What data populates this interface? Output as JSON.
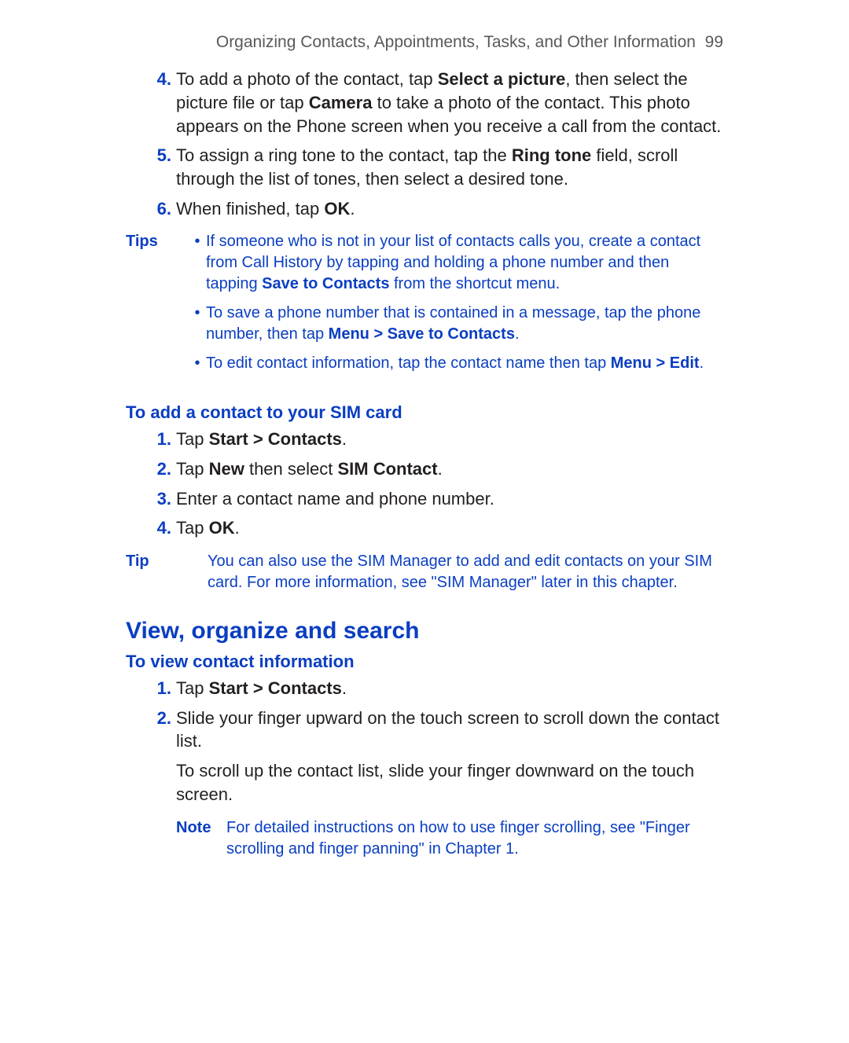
{
  "header": {
    "title": "Organizing Contacts, Appointments, Tasks, and Other Information",
    "page_number": "99"
  },
  "steps_a": {
    "s4": {
      "num": "4.",
      "pre": "To add a photo of the contact, tap ",
      "b1": "Select a picture",
      "mid1": ", then select the picture file or tap ",
      "b2": "Camera",
      "post": " to take a photo of the contact. This photo appears on the Phone screen when you receive a call from the contact."
    },
    "s5": {
      "num": "5.",
      "pre": "To assign a ring tone to the contact, tap the ",
      "b1": "Ring tone",
      "post": " field, scroll through the list of tones, then select a desired tone."
    },
    "s6": {
      "num": "6.",
      "pre": "When finished, tap ",
      "b1": "OK",
      "post": "."
    }
  },
  "tips": {
    "label": "Tips",
    "t1": {
      "pre": "If someone who is not in your list of contacts calls you, create a contact from Call History by tapping and holding a phone number and then tapping ",
      "b1": "Save to Contacts",
      "post": " from the shortcut menu."
    },
    "t2": {
      "pre": "To save a phone number that is contained in a message, tap the phone number, then tap ",
      "b1": "Menu > Save to Contacts",
      "post": "."
    },
    "t3": {
      "pre": "To edit contact information, tap the contact name then tap ",
      "b1": "Menu > Edit",
      "post": "."
    }
  },
  "sim": {
    "heading": "To add a contact to your SIM card",
    "s1": {
      "num": "1.",
      "pre": "Tap ",
      "b1": "Start > Contacts",
      "post": "."
    },
    "s2": {
      "num": "2.",
      "pre": "Tap ",
      "b1": "New",
      "mid": " then select ",
      "b2": "SIM Contact",
      "post": "."
    },
    "s3": {
      "num": "3.",
      "text": "Enter a contact name and phone number."
    },
    "s4": {
      "num": "4.",
      "pre": "Tap ",
      "b1": "OK",
      "post": "."
    }
  },
  "tip2": {
    "label": "Tip",
    "text": "You can also use the SIM Manager to add and edit contacts on your SIM card. For more information, see \"SIM Manager\" later in this chapter."
  },
  "section2": {
    "title": "View, organize and search",
    "heading": "To view contact information",
    "s1": {
      "num": "1.",
      "pre": "Tap ",
      "b1": "Start > Contacts",
      "post": "."
    },
    "s2": {
      "num": "2.",
      "text": "Slide your finger upward on the touch screen to scroll down the contact list."
    },
    "extra": "To scroll up the contact list, slide your finger downward on the touch screen.",
    "note": {
      "label": "Note",
      "text": "For detailed instructions on how to use finger scrolling, see \"Finger scrolling and finger panning\" in Chapter 1."
    }
  }
}
